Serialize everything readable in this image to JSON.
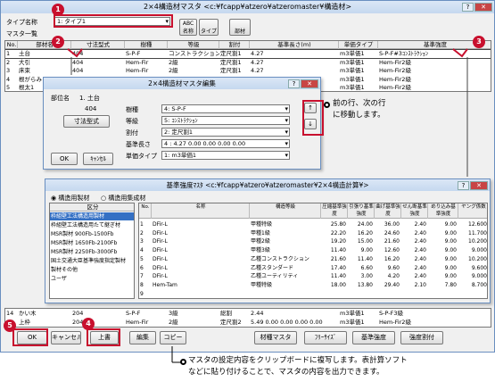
{
  "main_window": {
    "title": "2×4構造材マスタ <c:¥fcapp¥atzero¥atzeromaster¥構造材>",
    "type_name_label": "タイプ名称",
    "type_name_value": "1: タイプ1",
    "master_label": "マスタ一覧",
    "abc_button": "ABC",
    "name_button": "名称",
    "type_button": "タイプ",
    "parts_button": "部材",
    "table_headers": [
      "No.",
      "部材名",
      "寸法型式",
      "樹種",
      "等級",
      "割付",
      "基準長さ(m)",
      "単価タイプ",
      "基準強度"
    ],
    "rows": [
      [
        "1",
        "土台",
        "404",
        "S-P-F",
        "コンストラクション",
        "定尺割1",
        "4.27",
        "m3単価1",
        "S-P-F#3ｺﾝｽﾄﾗｸｼｮﾝ"
      ],
      [
        "2",
        "大引",
        "404",
        "Hem-Fir",
        "2級",
        "定尺割1",
        "4.27",
        "m3単価1",
        "Hem-Fir2級"
      ],
      [
        "3",
        "床束",
        "404",
        "Hem-Fir",
        "2級",
        "定尺割1",
        "4.27",
        "m3単価1",
        "Hem-Fir2級"
      ],
      [
        "4",
        "根がらみ",
        "",
        "",
        "",
        "",
        "",
        "m3単価1",
        "Hem-Fir2級"
      ],
      [
        "5",
        "根太1",
        "",
        "",
        "",
        "",
        "",
        "m3単価1",
        "Hem-Fir2級"
      ]
    ],
    "bottom_rows": [
      [
        "14",
        "かい木",
        "204",
        "S-P-F",
        "3級",
        "総割",
        "2.44",
        "m3単価1",
        "S-P-F3級"
      ],
      [
        "15",
        "上枠",
        "204",
        "Hem-Fir",
        "2級",
        "定尺割2",
        "5.49  0.00  0.00  0.00  0.00",
        "m3単価1",
        "Hem-Fir2級"
      ]
    ],
    "ok_button": "OK",
    "cancel_button": "キャンセル",
    "move_up_button": "上書",
    "edit_button": "編集",
    "copy_button": "コピー",
    "material_master_button": "材種マスタ",
    "free_size_button": "ﾌﾘｰｻｲｽﾞ",
    "base_strength_button": "基準強度",
    "strength_split_button": "強度割付"
  },
  "edit_dialog": {
    "title": "2×4構造材マスタ編集",
    "part_name_label": "部位名",
    "part_name_value": "1. 土台",
    "size_value": "404",
    "size_button": "寸法型式",
    "species_label": "樹種",
    "species_value": "4: S-P-F",
    "grade_label": "等級",
    "grade_value": "5: ｺﾝｽﾄﾗｸｼｮﾝ",
    "split_label": "割付",
    "split_value": "2: 定尺割1",
    "length_label": "基準長さ",
    "length_value": "4 :  4.27  0.00  0.00  0.00  0.00",
    "unit_label": "単価タイプ",
    "unit_value": "1: m3単価1",
    "ok_button": "OK",
    "cancel_button": "ｷｬﾝｾﾙ",
    "up_arrow": "↑",
    "down_arrow": "↓"
  },
  "strength_window": {
    "title": "基準強度ﾏｽﾀ <c:¥fcapp¥atzero¥atzeromaster¥2×4構造計算¥>",
    "radio1": "構造用製材",
    "radio2": "構造用集成材",
    "list_header": "区分",
    "categories": [
      "枠組壁工法構造用製材",
      "枠組壁工法構造用たて継ぎ材",
      "MSR製材 900Fb-1500Fb",
      "MSR製材 1650Fb-2100Fb",
      "MSR製材 2250Fb-3000Fb",
      "国土交通大臣基準強度指定製材",
      "製材その他",
      "ユーザ"
    ],
    "headers": [
      "No.",
      "名称",
      "構造等級",
      "圧縮基準強度",
      "引張り基準強度",
      "曲げ基準強度",
      "せん断基準強度",
      "めり込み基準強度",
      "ヤング係数"
    ],
    "rows": [
      [
        "1",
        "DFir-L",
        "甲種特級",
        "25.80",
        "24.00",
        "36.00",
        "2.40",
        "9.00",
        "12.600"
      ],
      [
        "2",
        "DFir-L",
        "甲種1級",
        "22.20",
        "16.20",
        "24.60",
        "2.40",
        "9.00",
        "11.700"
      ],
      [
        "3",
        "DFir-L",
        "甲種2級",
        "19.20",
        "15.00",
        "21.60",
        "2.40",
        "9.00",
        "10.200"
      ],
      [
        "4",
        "DFir-L",
        "甲種3級",
        "11.40",
        "9.00",
        "12.60",
        "2.40",
        "9.00",
        "9.000"
      ],
      [
        "5",
        "DFir-L",
        "乙種コンストラクション",
        "21.60",
        "11.40",
        "16.20",
        "2.40",
        "9.00",
        "10.200"
      ],
      [
        "6",
        "DFir-L",
        "乙種スタンダード",
        "17.40",
        "6.60",
        "9.60",
        "2.40",
        "9.00",
        "9.600"
      ],
      [
        "7",
        "DFir-L",
        "乙種ユーティリティ",
        "11.40",
        "3.00",
        "4.20",
        "2.40",
        "9.00",
        "9.000"
      ],
      [
        "8",
        "Hem-Tam",
        "甲種特級",
        "18.00",
        "13.80",
        "29.40",
        "2.10",
        "7.80",
        "8.700"
      ],
      [
        "9",
        "",
        "",
        "",
        "",
        "",
        "",
        "",
        ""
      ]
    ]
  },
  "annotations": {
    "marker1": "1",
    "marker2": "2",
    "marker3": "3",
    "marker4": "4",
    "marker5": "5",
    "note_arrows": "前の行、次の行\nに移動します。",
    "note_copy": "マスタの設定内容をクリップボードに複写します。表計算ソフト\nなどに貼り付けることで、マスタの内容を出力できます。"
  },
  "colors": {
    "accent_red": "#c8102e",
    "title_bg": "#c5d8ef"
  }
}
